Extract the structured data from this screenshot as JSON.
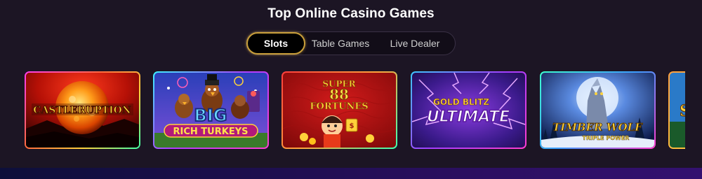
{
  "header": {
    "title": "Top Online Casino Games"
  },
  "tabs": [
    {
      "label": "Slots",
      "active": true
    },
    {
      "label": "Table Games",
      "active": false
    },
    {
      "label": "Live Dealer",
      "active": false
    }
  ],
  "games": [
    {
      "title": "CASTLERUPTION"
    },
    {
      "title_line1": "BIG",
      "title_line2": "RICH TURKEYS"
    },
    {
      "title_line1": "SUPER",
      "title_line2": "88",
      "title_line3": "FORTUNES"
    },
    {
      "title_line1": "GOLD BLITZ",
      "title_line2": "ULTIMATE"
    },
    {
      "title_line1": "TIMBER WOLF",
      "title_line2": "TRIPLE POWER"
    },
    {
      "title": "S"
    }
  ]
}
